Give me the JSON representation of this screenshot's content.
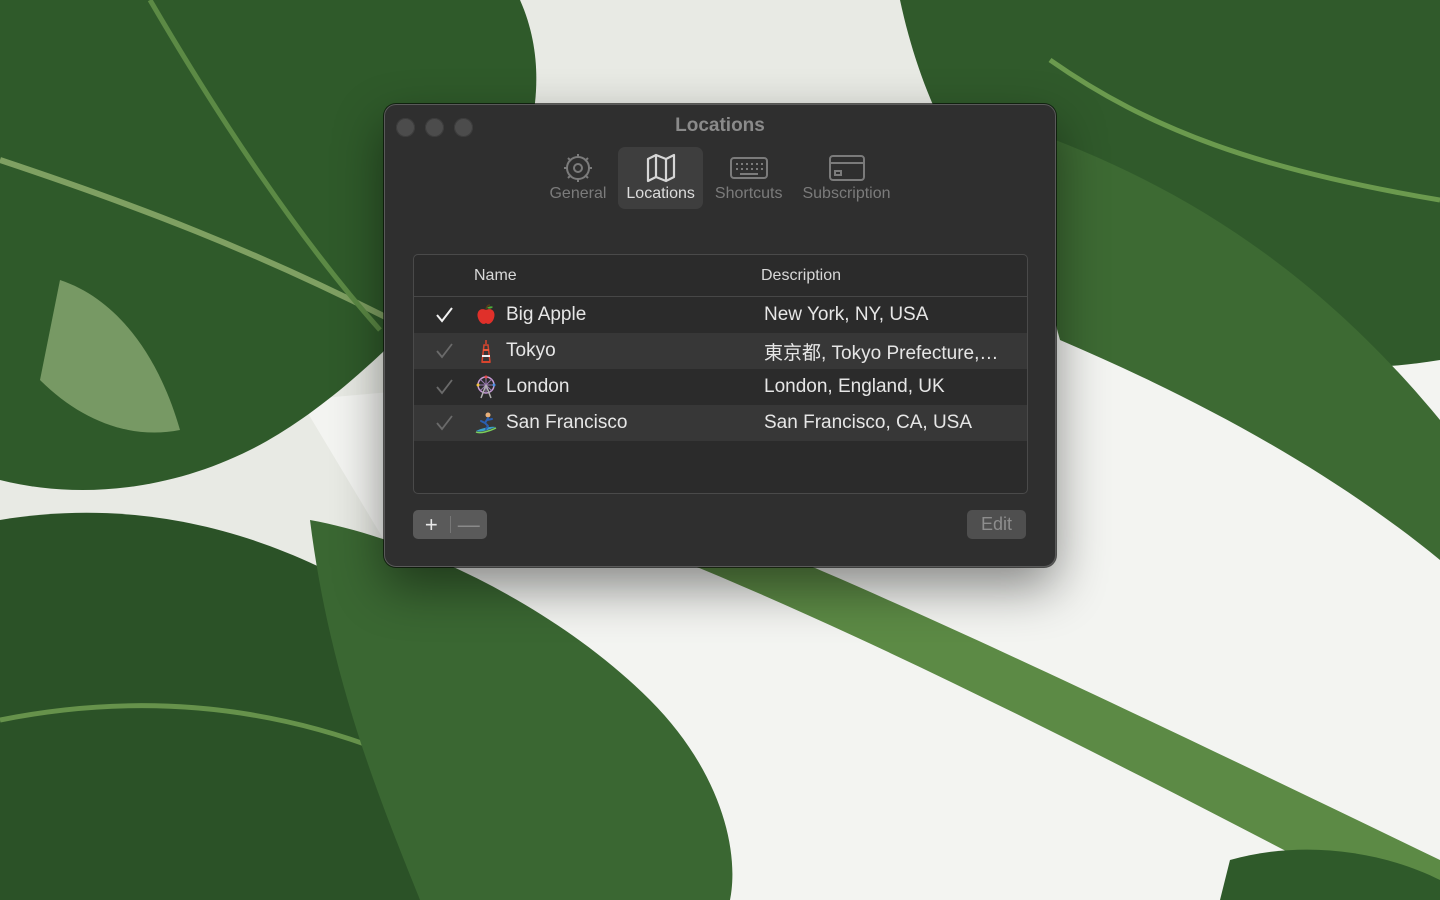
{
  "window": {
    "title": "Locations"
  },
  "toolbar": {
    "items": [
      {
        "label": "General",
        "icon": "gear-icon",
        "active": false
      },
      {
        "label": "Locations",
        "icon": "map-icon",
        "active": true
      },
      {
        "label": "Shortcuts",
        "icon": "keyboard-icon",
        "active": false
      },
      {
        "label": "Subscription",
        "icon": "credit-card-icon",
        "active": false
      }
    ]
  },
  "table": {
    "columns": {
      "name": "Name",
      "description": "Description"
    },
    "rows": [
      {
        "checked": true,
        "emoji": "red-apple-icon",
        "name": "Big Apple",
        "description": "New York, NY, USA"
      },
      {
        "checked": false,
        "emoji": "tokyo-tower-icon",
        "name": "Tokyo",
        "description": "東京都, Tokyo Prefecture,…"
      },
      {
        "checked": false,
        "emoji": "ferris-wheel-icon",
        "name": "London",
        "description": "London, England, UK"
      },
      {
        "checked": false,
        "emoji": "surfer-icon",
        "name": "San Francisco",
        "description": "San Francisco, CA, USA"
      }
    ]
  },
  "buttons": {
    "add": "+",
    "remove": "—",
    "edit": "Edit"
  },
  "colors": {
    "window_bg": "#2f2f2f",
    "active_tab_bg": "#3e3e3e",
    "row_alt_bg": "#373737"
  }
}
